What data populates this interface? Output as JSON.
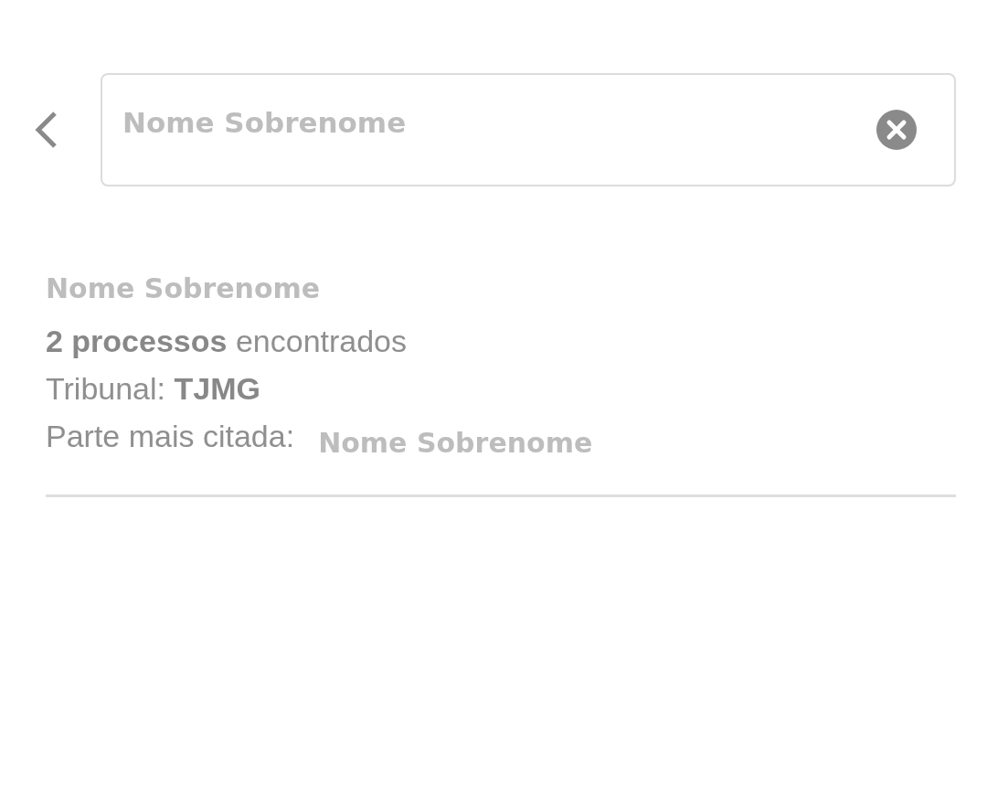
{
  "search": {
    "value": "Nome Sobrenome"
  },
  "result": {
    "name": "Nome Sobrenome",
    "lines": [
      {
        "kind": "text",
        "text": "**2 processos** encontrados"
      },
      {
        "kind": "text",
        "text": "Tribunal: **TJMG**"
      },
      {
        "kind": "party",
        "label": "Parte mais citada:",
        "value": "Nome Sobrenome"
      }
    ]
  }
}
